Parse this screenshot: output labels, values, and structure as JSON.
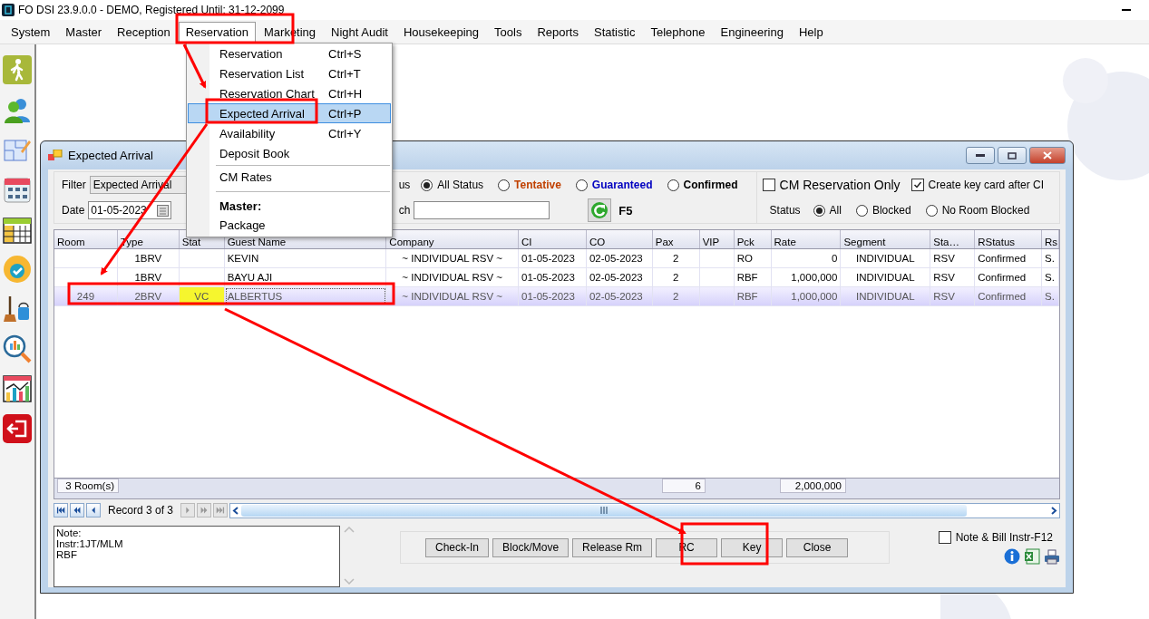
{
  "app_title": "FO DSI 23.9.0.0 - DEMO, Registered Until: 31-12-2099",
  "menu_bar": [
    {
      "label": "System",
      "selected": false
    },
    {
      "label": "Master",
      "selected": false
    },
    {
      "label": "Reception",
      "selected": false
    },
    {
      "label": "Reservation",
      "selected": true
    },
    {
      "label": "Marketing",
      "selected": false
    },
    {
      "label": "Night Audit",
      "selected": false
    },
    {
      "label": "Housekeeping",
      "selected": false
    },
    {
      "label": "Tools",
      "selected": false
    },
    {
      "label": "Reports",
      "selected": false
    },
    {
      "label": "Statistic",
      "selected": false
    },
    {
      "label": "Telephone",
      "selected": false
    },
    {
      "label": "Engineering",
      "selected": false
    },
    {
      "label": "Help",
      "selected": false
    }
  ],
  "dropdown": [
    {
      "kind": "item",
      "label": "Reservation",
      "shortcut": "Ctrl+S",
      "selected": false
    },
    {
      "kind": "item",
      "label": "Reservation List",
      "shortcut": "Ctrl+T",
      "selected": false
    },
    {
      "kind": "item",
      "label": "Reservation Chart",
      "shortcut": "Ctrl+H",
      "selected": false
    },
    {
      "kind": "item",
      "label": "Expected Arrival",
      "shortcut": "Ctrl+P",
      "selected": true
    },
    {
      "kind": "item",
      "label": "Availability",
      "shortcut": "Ctrl+Y",
      "selected": false
    },
    {
      "kind": "item",
      "label": "Deposit Book",
      "selected": false
    },
    {
      "kind": "separator"
    },
    {
      "kind": "item",
      "label": "CM Rates",
      "selected": false
    },
    {
      "kind": "separator"
    },
    {
      "kind": "header",
      "label": "Master:"
    },
    {
      "kind": "item",
      "label": "Package",
      "selected": false
    }
  ],
  "window": {
    "title": "Expected Arrival",
    "filter": {
      "label": "Filter",
      "value": "Expected Arrival",
      "date_label": "Date",
      "date": "01-05-2023",
      "status_label": "us",
      "search_label": "ch",
      "refresh_key": "F5",
      "status_options": [
        {
          "label": "All Status",
          "selected": true,
          "color": "#000000",
          "bold": false
        },
        {
          "label": "Tentative",
          "selected": false,
          "color": "#c04000",
          "bold": true
        },
        {
          "label": "Guaranteed",
          "selected": false,
          "color": "#0000c0",
          "bold": true
        },
        {
          "label": "Confirmed",
          "selected": false,
          "color": "#000000",
          "bold": true
        }
      ],
      "cm_only": {
        "label": "CM Reservation Only",
        "checked": false
      },
      "key_card": {
        "label": "Create key card after CI",
        "checked": true
      },
      "room_status_label": "Status",
      "room_status": [
        {
          "label": "All",
          "selected": true
        },
        {
          "label": "Blocked",
          "selected": false
        },
        {
          "label": "No Room Blocked",
          "selected": false
        }
      ]
    },
    "table": {
      "columns": [
        "Room",
        "Type",
        "Stat",
        "Guest Name",
        "Company",
        "CI",
        "CO",
        "Pax",
        "VIP",
        "Pck",
        "Rate",
        "Segment",
        "Sta…",
        "RStatus",
        "Rs"
      ],
      "rows": [
        {
          "selected": false,
          "type": "1BRV",
          "guest_name": "KEVIN",
          "company": "~ INDIVIDUAL RSV ~",
          "ci": "01-05-2023",
          "co": "02-05-2023",
          "pax": "2",
          "pck": "RO",
          "rate": "0",
          "segment": "INDIVIDUAL",
          "sta": "RSV",
          "rstatus": "Confirmed",
          "column_15": "S."
        },
        {
          "selected": false,
          "type": "1BRV",
          "guest_name": "BAYU AJI",
          "company": "~ INDIVIDUAL RSV ~",
          "ci": "01-05-2023",
          "co": "02-05-2023",
          "pax": "2",
          "pck": "RBF",
          "rate": "1,000,000",
          "segment": "INDIVIDUAL",
          "sta": "RSV",
          "rstatus": "Confirmed",
          "column_15": "S."
        },
        {
          "selected": true,
          "room": "249",
          "type": "2BRV",
          "stat": "VC",
          "color": "#f6f62e",
          "guest_name": "ALBERTUS",
          "company": "~ INDIVIDUAL RSV ~",
          "ci": "01-05-2023",
          "co": "02-05-2023",
          "pax": "2",
          "pck": "RBF",
          "rate": "1,000,000",
          "segment": "INDIVIDUAL",
          "sta": "RSV",
          "rstatus": "Confirmed",
          "column_15": "S."
        }
      ],
      "footer": {
        "rooms": "3 Room(s)",
        "pax": "6",
        "rate": "2,000,000"
      }
    },
    "navigator": {
      "record": "Record 3 of 3",
      "buttons": [
        {
          "kind": "first",
          "disabled": false
        },
        {
          "kind": "prev_page",
          "disabled": false
        },
        {
          "kind": "prev",
          "disabled": false
        },
        {
          "kind": "next",
          "disabled": true
        },
        {
          "kind": "next_page",
          "disabled": true
        },
        {
          "kind": "last",
          "disabled": true
        }
      ]
    },
    "note": "Note:\nInstr:1JT/MLM\nRBF",
    "buttons": [
      "Check-In",
      "Block/Move",
      "Release Rm",
      "RC",
      "Key",
      "Close"
    ],
    "note_bill": {
      "label": "Note & Bill Instr-F12",
      "checked": false
    }
  }
}
